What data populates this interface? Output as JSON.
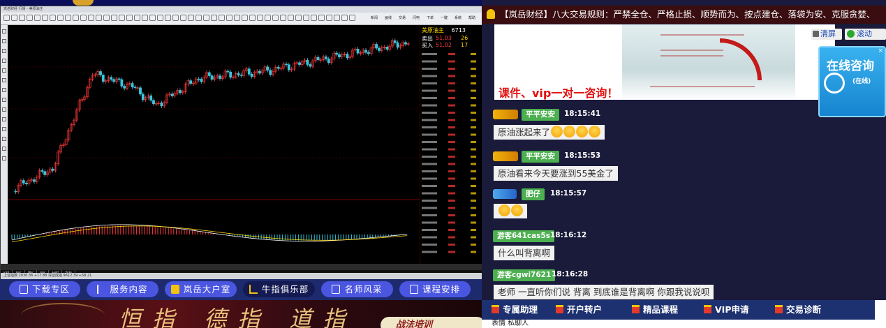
{
  "trading": {
    "window_title": "岚岳财经 行情 - 美原油主",
    "toolbar_labels": [
      "新闻",
      "画线",
      "交易",
      "闪电",
      "下单",
      "一键",
      "系统",
      "帮助"
    ],
    "instrument_title": "美原油主",
    "instrument_code": "6713",
    "bid_label": "卖出",
    "bid_price": "51.03",
    "bid_vol": "26",
    "ask_label": "买入",
    "ask_price": "51.02",
    "ask_vol": "17",
    "bottom_tabs": [
      "K线",
      "日K",
      "周K",
      "月K",
      "分时",
      "指标"
    ],
    "status_text": "上证指数 2936.36 +17.88 深证成指 9612.39 +58.21"
  },
  "nav": {
    "download": "下载专区",
    "services": "服务内容",
    "big_client": "岚岳大户室",
    "bull_club": "牛指俱乐部",
    "teachers": "名师风采",
    "schedule": "课程安排"
  },
  "banner": {
    "title": "恒指 德指 道指",
    "badge": "战法培训"
  },
  "chat": {
    "notice": "【岚岳财经】八大交易规则：严禁全仓、严格止损、顺势而为、按点建仓、落袋为安、克服贪婪、",
    "promo_text": "课件、vip一对一咨询！",
    "clear_label": "清屏",
    "scroll_label": "滚动",
    "consult_title": "在线咨询",
    "consult_status": "(在线)",
    "messages": [
      {
        "user": "平平安安",
        "time": "18:15:41",
        "text": "原油涨起来了",
        "emoji_count": 4,
        "level": "gold"
      },
      {
        "user": "平平安安",
        "time": "18:15:53",
        "text": "原油看来今天要涨到55美金了",
        "emoji_count": 0,
        "level": "gold"
      },
      {
        "user": "肥仔",
        "time": "18:15:57",
        "text": "",
        "emoji_count": 2,
        "level": "blue"
      },
      {
        "user": "游客641cas5s",
        "time": "18:16:12",
        "text": "什么叫背离啊",
        "emoji_count": 0,
        "level": ""
      },
      {
        "user": "游客cgwi7621",
        "time": "18:16:28",
        "text": "老师 一直听你们说  背离  到底谁是背离啊  你跟我说说呗",
        "emoji_count": 0,
        "level": ""
      }
    ],
    "actions": [
      "专属助理",
      "开户转户",
      "精品课程",
      "VIP申请",
      "交易诊断"
    ],
    "input_hint": "表情  私聊人"
  },
  "colors": {
    "nav_button": "#4a55e0",
    "nav_button_active": "#141a52",
    "chat_bg": "#1a1a3a",
    "username_bg": "#4caf50",
    "promo_red": "#e21111",
    "chart_bg": "#000000",
    "candle_up": "#ff3b3b",
    "candle_down": "#39c6dc"
  }
}
